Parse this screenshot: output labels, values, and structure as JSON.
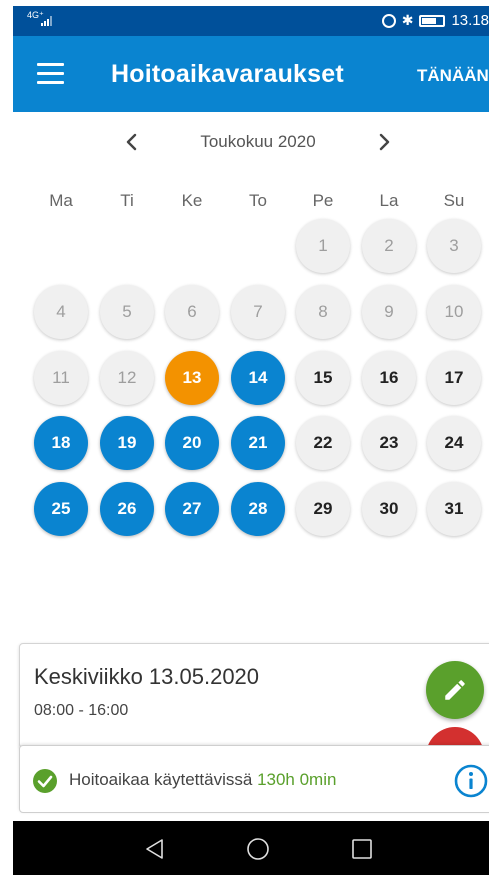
{
  "status_bar": {
    "network": "4G⁺",
    "time": "13.18"
  },
  "app_bar": {
    "title": "Hoitoaikavaraukset",
    "today_label": "TÄNÄÄN"
  },
  "calendar": {
    "month_label": "Toukokuu 2020",
    "weekdays": [
      "Ma",
      "Ti",
      "Ke",
      "To",
      "Pe",
      "La",
      "Su"
    ],
    "days": [
      {
        "label": "1",
        "status": "past"
      },
      {
        "label": "2",
        "status": "past"
      },
      {
        "label": "3",
        "status": "past"
      },
      {
        "label": "4",
        "status": "past"
      },
      {
        "label": "5",
        "status": "past"
      },
      {
        "label": "6",
        "status": "past"
      },
      {
        "label": "7",
        "status": "past"
      },
      {
        "label": "8",
        "status": "past"
      },
      {
        "label": "9",
        "status": "past"
      },
      {
        "label": "10",
        "status": "past"
      },
      {
        "label": "11",
        "status": "past"
      },
      {
        "label": "12",
        "status": "past"
      },
      {
        "label": "13",
        "status": "today"
      },
      {
        "label": "14",
        "status": "booked"
      },
      {
        "label": "15",
        "status": "free"
      },
      {
        "label": "16",
        "status": "free"
      },
      {
        "label": "17",
        "status": "free"
      },
      {
        "label": "18",
        "status": "booked"
      },
      {
        "label": "19",
        "status": "booked"
      },
      {
        "label": "20",
        "status": "booked"
      },
      {
        "label": "21",
        "status": "booked"
      },
      {
        "label": "22",
        "status": "free"
      },
      {
        "label": "23",
        "status": "free"
      },
      {
        "label": "24",
        "status": "free"
      },
      {
        "label": "25",
        "status": "booked"
      },
      {
        "label": "26",
        "status": "booked"
      },
      {
        "label": "27",
        "status": "booked"
      },
      {
        "label": "28",
        "status": "booked"
      },
      {
        "label": "29",
        "status": "free"
      },
      {
        "label": "30",
        "status": "free"
      },
      {
        "label": "31",
        "status": "free"
      }
    ]
  },
  "detail": {
    "date": "Keskiviikko 13.05.2020",
    "time": "08:00 - 16:00"
  },
  "availability": {
    "label": "Hoitoaikaa käytettävissä",
    "value": "130h 0min"
  },
  "icons": {
    "menu": "hamburger-menu-icon",
    "prev": "chevron-left-icon",
    "next": "chevron-right-icon",
    "edit": "pencil-icon",
    "check": "check-circle-icon",
    "info": "info-icon"
  },
  "colors": {
    "status_bar": "#00509a",
    "app_bar": "#0a84d0",
    "booked": "#0a84d0",
    "today": "#f39200",
    "day_bg": "#f0f0f0",
    "edit": "#5aa02c",
    "delete": "#d3302f",
    "available_value": "#5aa02c"
  }
}
